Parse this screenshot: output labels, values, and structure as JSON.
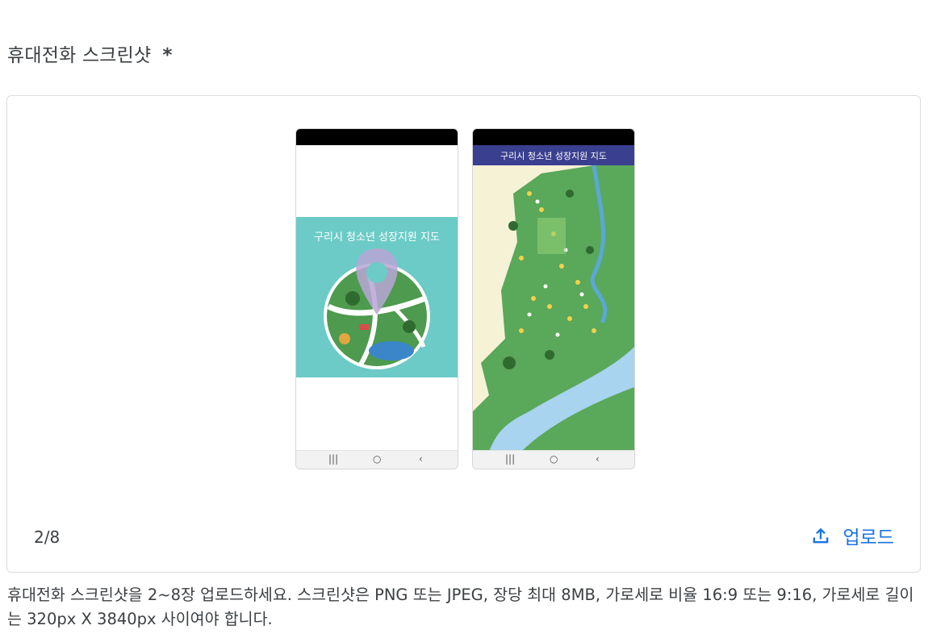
{
  "field": {
    "label": "휴대전화 스크린샷",
    "required_mark": "*"
  },
  "screenshots": [
    {
      "title": "구리시 청소년 성장지원 지도",
      "nav_icons": [
        "recents-icon",
        "home-icon",
        "back-icon"
      ]
    },
    {
      "title": "구리시 청소년 성장지원 지도",
      "nav_icons": [
        "recents-icon",
        "home-icon",
        "back-icon"
      ]
    }
  ],
  "counter": "2/8",
  "upload": {
    "label": "업로드",
    "icon": "upload-icon",
    "color": "#1a73e8"
  },
  "helper_text": "휴대전화 스크린샷을 2~8장 업로드하세요. 스크린샷은 PNG 또는 JPEG, 장당 최대 8MB, 가로세로 비율 16:9 또는 9:16, 가로세로 길이는 320px X 3840px 사이여야 합니다."
}
